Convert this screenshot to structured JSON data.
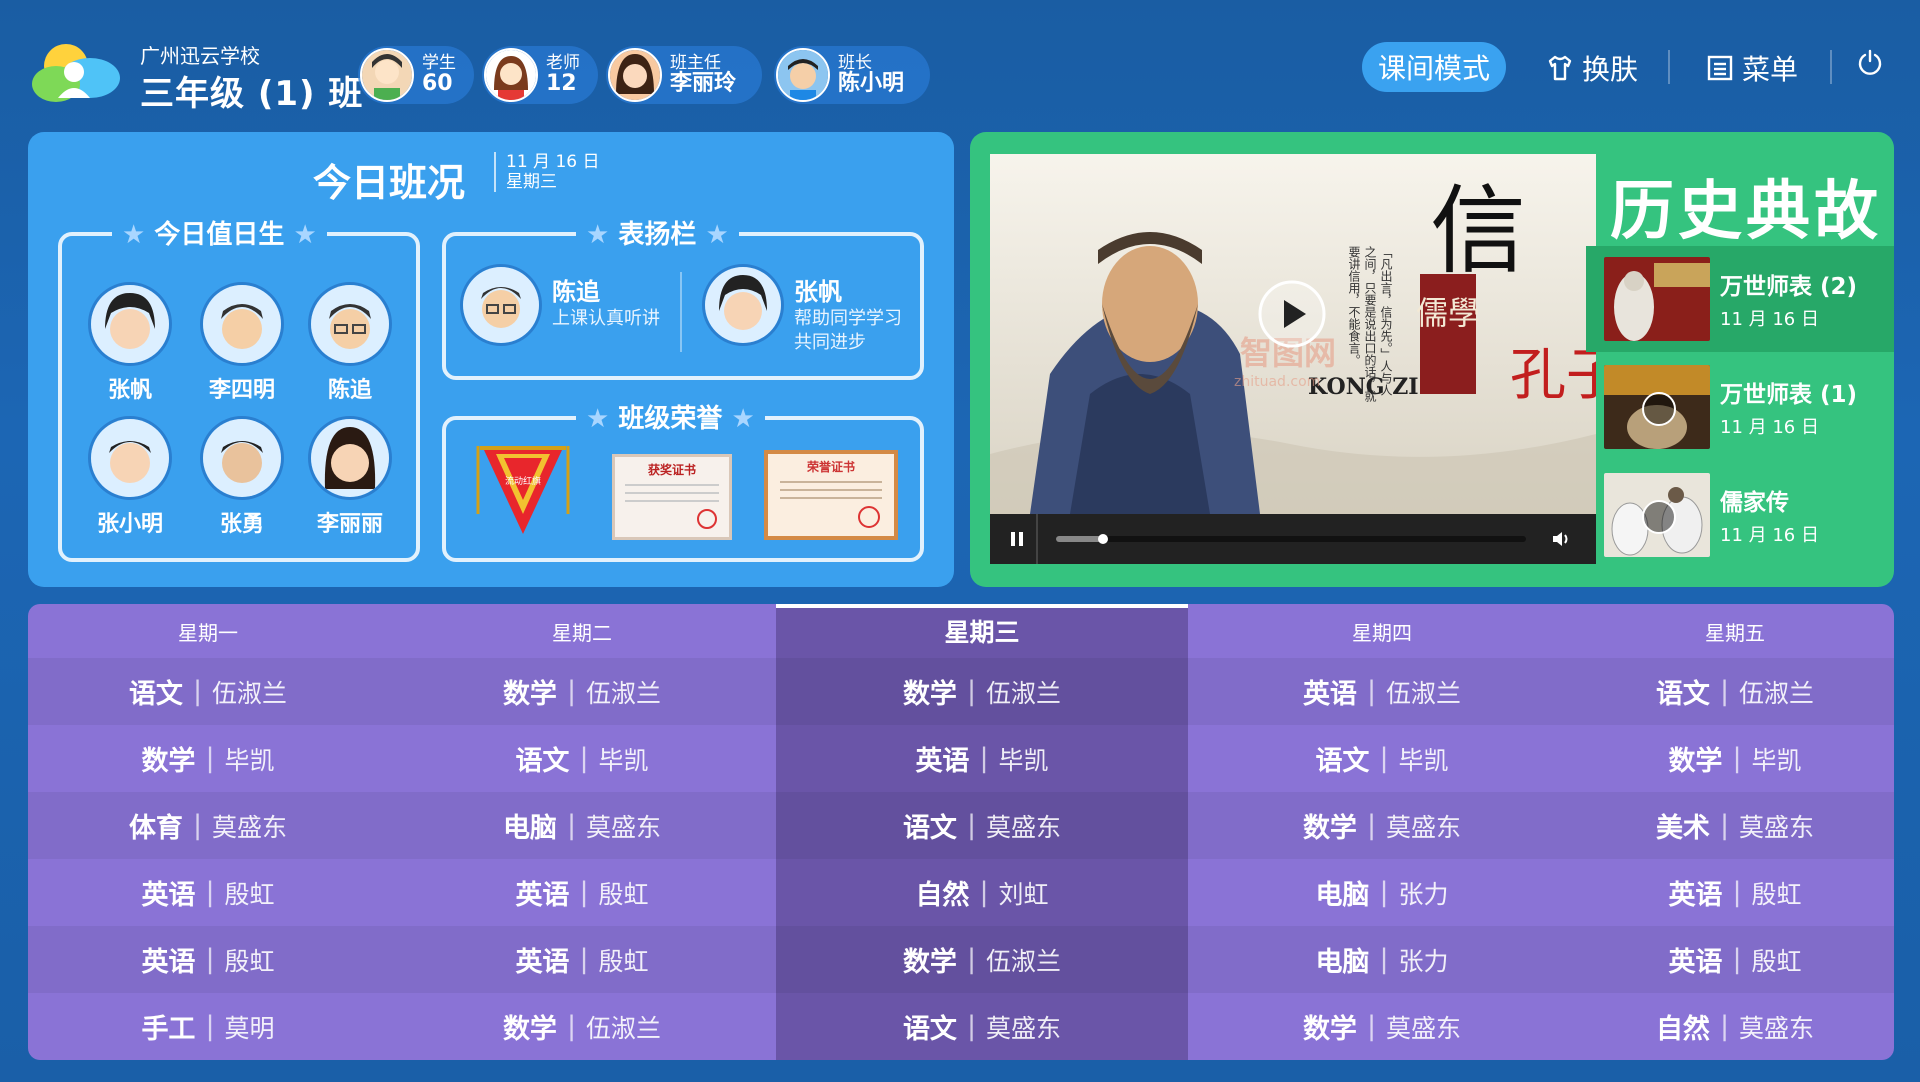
{
  "header": {
    "school": "广州迅云学校",
    "class_name": "三年级 (1) 班",
    "stats": [
      {
        "label": "学生",
        "value": "60"
      },
      {
        "label": "老师",
        "value": "12"
      },
      {
        "label": "班主任",
        "value": "李丽玲"
      },
      {
        "label": "班长",
        "value": "陈小明"
      }
    ],
    "mode_button": "课间模式",
    "skin_button": "换肤",
    "menu_button": "菜单"
  },
  "class_status": {
    "title": "今日班况",
    "date": "11 月 16 日",
    "weekday": "星期三",
    "duty_title": "今日值日生",
    "duty_students": [
      "张帆",
      "李四明",
      "陈追",
      "张小明",
      "张勇",
      "李丽丽"
    ],
    "praise_title": "表扬栏",
    "praise": [
      {
        "name": "陈追",
        "desc": "上课认真听讲"
      },
      {
        "name": "张帆",
        "desc": "帮助同学学习共同进步"
      }
    ],
    "honor_title": "班级荣誉",
    "honors": [
      {
        "type": "flag",
        "text": "流动红旗"
      },
      {
        "type": "certificate",
        "text": "获奖证书"
      },
      {
        "type": "certificate",
        "text": "荣誉证书"
      }
    ]
  },
  "history": {
    "title": "历史典故",
    "video": {
      "calligraphy": "信",
      "label_ru": "儒學",
      "name_cn": "孔子",
      "name_en": "KONG ZI",
      "quote": "「凡出言，信为先。」人与人之间，只要是说出口的话，就要讲信用，不能食言。",
      "watermark": "智图网",
      "watermark_url": "zhituad.com",
      "progress": 0.1
    },
    "items": [
      {
        "title": "万世师表 (2)",
        "date": "11 月 16 日"
      },
      {
        "title": "万世师表 (1)",
        "date": "11 月 16 日"
      },
      {
        "title": "儒家传",
        "date": "11 月 16 日"
      }
    ]
  },
  "timetable": {
    "days": [
      "星期一",
      "星期二",
      "星期三",
      "星期四",
      "星期五"
    ],
    "current_day": 2,
    "rows": [
      [
        [
          "语文",
          "伍淑兰"
        ],
        [
          "数学",
          "伍淑兰"
        ],
        [
          "数学",
          "伍淑兰"
        ],
        [
          "英语",
          "伍淑兰"
        ],
        [
          "语文",
          "伍淑兰"
        ]
      ],
      [
        [
          "数学",
          "毕凯"
        ],
        [
          "语文",
          "毕凯"
        ],
        [
          "英语",
          "毕凯"
        ],
        [
          "语文",
          "毕凯"
        ],
        [
          "数学",
          "毕凯"
        ]
      ],
      [
        [
          "体育",
          "莫盛东"
        ],
        [
          "电脑",
          "莫盛东"
        ],
        [
          "语文",
          "莫盛东"
        ],
        [
          "数学",
          "莫盛东"
        ],
        [
          "美术",
          "莫盛东"
        ]
      ],
      [
        [
          "英语",
          "殷虹"
        ],
        [
          "英语",
          "殷虹"
        ],
        [
          "自然",
          "刘虹"
        ],
        [
          "电脑",
          "张力"
        ],
        [
          "英语",
          "殷虹"
        ]
      ],
      [
        [
          "英语",
          "殷虹"
        ],
        [
          "英语",
          "殷虹"
        ],
        [
          "数学",
          "伍淑兰"
        ],
        [
          "电脑",
          "张力"
        ],
        [
          "英语",
          "殷虹"
        ]
      ],
      [
        [
          "手工",
          "莫明"
        ],
        [
          "数学",
          "伍淑兰"
        ],
        [
          "语文",
          "莫盛东"
        ],
        [
          "数学",
          "莫盛东"
        ],
        [
          "自然",
          "莫盛东"
        ]
      ]
    ]
  }
}
